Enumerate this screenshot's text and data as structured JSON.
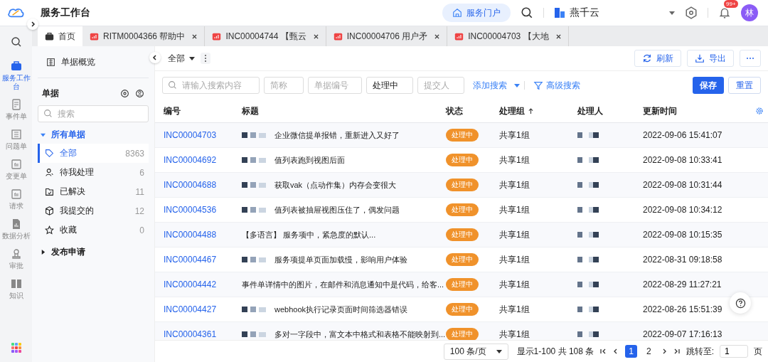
{
  "app": {
    "title": "服务工作台"
  },
  "header": {
    "portal_button": "服务门户",
    "tenant": "燕千云",
    "notification_badge": "99+",
    "avatar": "林"
  },
  "tabs": [
    {
      "label": "首页",
      "kind": "home",
      "selected": true
    },
    {
      "label": "RITM0004366 帮助中",
      "kind": "ticket",
      "selected": false
    },
    {
      "label": "INC00004744 【甄云",
      "kind": "ticket",
      "selected": false
    },
    {
      "label": "INC00004706 用户矛",
      "kind": "ticket",
      "selected": false
    },
    {
      "label": "INC00004703 【大地",
      "kind": "ticket",
      "selected": false
    }
  ],
  "rail": [
    {
      "label": "服务工作台",
      "kind": "briefcase",
      "selected": true
    },
    {
      "label": "事件单",
      "kind": "doc",
      "selected": false
    },
    {
      "label": "问题单",
      "kind": "list",
      "selected": false
    },
    {
      "label": "变更单",
      "kind": "swap",
      "selected": false
    },
    {
      "label": "请求",
      "kind": "swap",
      "selected": false
    },
    {
      "label": "数据分析",
      "kind": "chart",
      "selected": false
    },
    {
      "label": "审批",
      "kind": "stamp",
      "selected": false
    },
    {
      "label": "知识",
      "kind": "book",
      "selected": false
    }
  ],
  "sidebar": {
    "overview": "单据概览",
    "section": "单据",
    "search_placeholder": "搜索",
    "groups": [
      {
        "label": "所有单据",
        "expanded": true,
        "children": [
          {
            "label": "全部",
            "count": "8363",
            "kind": "tag",
            "selected": true
          },
          {
            "label": "待我处理",
            "count": "6",
            "kind": "user",
            "selected": false
          },
          {
            "label": "已解决",
            "count": "11",
            "kind": "folder",
            "selected": false
          },
          {
            "label": "我提交的",
            "count": "12",
            "kind": "cube",
            "selected": false
          },
          {
            "label": "收藏",
            "count": "0",
            "kind": "star",
            "selected": false
          }
        ]
      },
      {
        "label": "发布申请",
        "expanded": false
      }
    ]
  },
  "toolbar": {
    "view": "全部",
    "refresh": "刷新",
    "export": "导出"
  },
  "filters": {
    "search_placeholder": "请输入搜索内容",
    "fields": [
      {
        "placeholder": "简称"
      },
      {
        "placeholder": "单据编号"
      },
      {
        "value": "处理中"
      },
      {
        "placeholder": "提交人"
      }
    ],
    "add_search": "添加搜索",
    "advanced": "高级搜索",
    "save": "保存",
    "reset": "重置"
  },
  "table": {
    "columns": [
      "编号",
      "标题",
      "状态",
      "处理组",
      "处理人",
      "更新时间"
    ],
    "rows": [
      {
        "id": "INC00004703",
        "title": "企业微信提单报错，重新进入又好了",
        "redacted": true,
        "status": "处理中",
        "group": "共享1组",
        "time": "2022-09-06 15:41:07"
      },
      {
        "id": "INC00004692",
        "title": "值列表跑到视图后面",
        "redacted": true,
        "status": "处理中",
        "group": "共享1组",
        "time": "2022-09-08 10:33:41"
      },
      {
        "id": "INC00004688",
        "title": "获取vak（点动作集）内存会变很大",
        "redacted": true,
        "status": "处理中",
        "group": "共享1组",
        "time": "2022-09-08 10:31:44"
      },
      {
        "id": "INC00004536",
        "title": "值列表被抽屉视图压住了，偶发问题",
        "redacted": true,
        "status": "处理中",
        "group": "共享1组",
        "time": "2022-09-08 10:34:12"
      },
      {
        "id": "INC00004488",
        "title": "【多语言】 服务项中，紧急度的默认...",
        "redacted": false,
        "status": "处理中",
        "group": "共享1组",
        "time": "2022-09-08 10:15:35"
      },
      {
        "id": "INC00004467",
        "title": "服务项提单页面加载慢，影响用户体验",
        "redacted": true,
        "status": "处理中",
        "group": "共享1组",
        "time": "2022-08-31 09:18:58"
      },
      {
        "id": "INC00004442",
        "title": "事件单详情中的图片，在邮件和消息通知中是代码，给客...",
        "redacted": false,
        "status": "处理中",
        "group": "共享1组",
        "time": "2022-08-29 11:27:21"
      },
      {
        "id": "INC00004427",
        "title": "webhook执行记录页面时间筛选器错误",
        "redacted": true,
        "status": "处理中",
        "group": "共享1组",
        "time": "2022-08-26 15:51:39"
      },
      {
        "id": "INC00004361",
        "title": "多对一字段中，富文本中格式和表格不能映射到...",
        "redacted": true,
        "status": "处理中",
        "group": "共享1组",
        "time": "2022-09-07 17:16:13"
      }
    ]
  },
  "pagination": {
    "page_size": "100 条/页",
    "summary": "显示1-100 共 108 条",
    "pages": [
      {
        "label": "1",
        "selected": true
      },
      {
        "label": "2",
        "selected": false
      }
    ],
    "jump_label": "跳转至:",
    "jump_value": "1",
    "unit": "页"
  }
}
